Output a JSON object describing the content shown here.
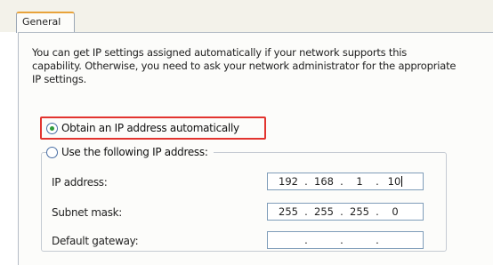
{
  "tabs": [
    {
      "label": "General",
      "selected": true
    }
  ],
  "description": "You can get IP settings assigned automatically if your network supports this capability. Otherwise, you need to ask your network administrator for the appropriate IP settings.",
  "options": {
    "automatic": {
      "label": "Obtain an IP address automatically",
      "selected": true
    },
    "manual": {
      "label": "Use the following IP address:",
      "selected": false
    }
  },
  "fields": {
    "ip_address": {
      "label": "IP address:",
      "octets": [
        "192",
        "168",
        "1",
        "10"
      ]
    },
    "subnet_mask": {
      "label": "Subnet mask:",
      "octets": [
        "255",
        "255",
        "255",
        "0"
      ]
    },
    "default_gateway": {
      "label": "Default gateway:",
      "octets": [
        "",
        "",
        "",
        ""
      ]
    }
  },
  "separator": ".",
  "colors": {
    "tab_accent": "#e8a33b",
    "highlight_border": "#e2342f",
    "radio_selected": "#2e9b3a",
    "input_border": "#7f9db9"
  }
}
